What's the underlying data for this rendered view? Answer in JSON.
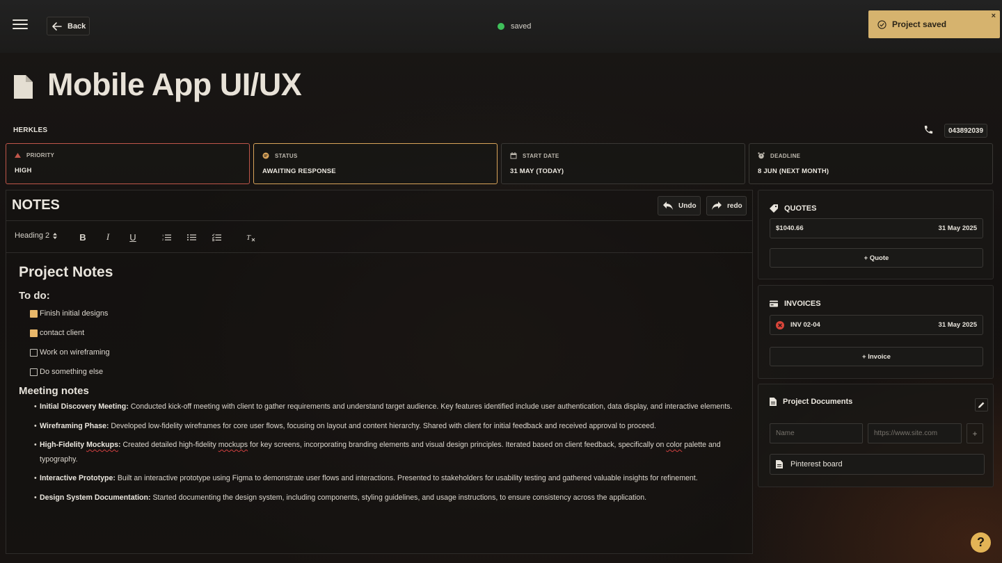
{
  "header": {
    "back_label": "Back",
    "save_status": "saved",
    "toast_message": "Project saved",
    "toast_close": "×"
  },
  "project": {
    "title": "Mobile App UI/UX",
    "client": "HERKLES",
    "phone": "043892039"
  },
  "meta": {
    "priority": {
      "label": "PRIORITY",
      "value": "HIGH",
      "color": "#c0564a"
    },
    "status": {
      "label": "STATUS",
      "value": "AWAITING RESPONSE",
      "color": "#d9a45a"
    },
    "start_date": {
      "label": "START DATE",
      "value": "31 MAY (TODAY)"
    },
    "deadline": {
      "label": "DEADLINE",
      "value": "8 JUN (NEXT MONTH)"
    }
  },
  "notes": {
    "title": "NOTES",
    "undo_label": "Undo",
    "redo_label": "redo",
    "toolbar": {
      "heading_select": "Heading 2"
    },
    "heading": "Project Notes",
    "todo_heading": "To do:",
    "todos": [
      {
        "label": "Finish initial designs",
        "checked": true
      },
      {
        "label": "contact client",
        "checked": true
      },
      {
        "label": "Work on wireframing",
        "checked": false
      },
      {
        "label": "Do something else",
        "checked": false
      }
    ],
    "meeting_heading": "Meeting notes",
    "meeting_notes": [
      {
        "title": "Initial Discovery Meeting:",
        "text": " Conducted kick-off meeting with client to gather requirements and understand target audience. Key features identified include user authentication, data display, and interactive elements."
      },
      {
        "title": "Wireframing Phase:",
        "text": " Developed low-fidelity wireframes for core user flows, focusing on layout and content hierarchy. Shared with client for initial feedback and received approval to proceed."
      },
      {
        "title": "High-Fidelity ",
        "title_sq": "Mockups",
        "title_end": ":",
        "text": " Created detailed high-fidelity ",
        "text_sq": "mockups",
        "text2": " for key screens, incorporating branding elements and visual design principles. Iterated based on client feedback, specifically on ",
        "text_sq2": "color",
        "text3": " palette and typography."
      },
      {
        "title": "Interactive Prototype:",
        "text": " Built an interactive prototype using Figma to demonstrate user flows and interactions. Presented to stakeholders for usability testing and gathered valuable insights for refinement."
      },
      {
        "title": "Design System Documentation:",
        "text": " Started documenting the design system, including components, styling guidelines, and usage instructions, to ensure consistency across the application."
      }
    ]
  },
  "quotes": {
    "title": "QUOTES",
    "items": [
      {
        "amount": "$1040.66",
        "date": "31 May 2025"
      }
    ],
    "add_label": "+ Quote"
  },
  "invoices": {
    "title": "INVOICES",
    "items": [
      {
        "id": "INV 02-04",
        "date": "31 May 2025",
        "status_color": "#d9453a"
      }
    ],
    "add_label": "+ Invoice"
  },
  "documents": {
    "title": "Project Documents",
    "name_placeholder": "Name",
    "url_placeholder": "https://www.site.com",
    "add_label": "+",
    "items": [
      {
        "name": "Pinterest board"
      }
    ]
  },
  "help_label": "?"
}
